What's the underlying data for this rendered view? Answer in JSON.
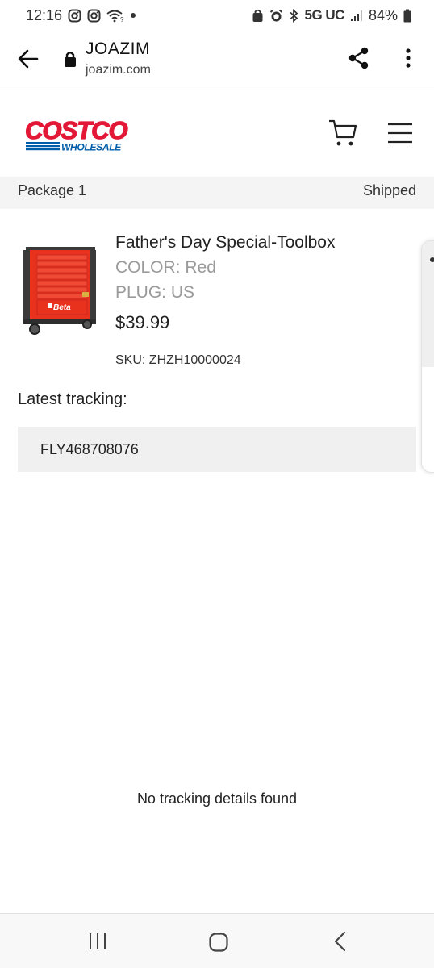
{
  "status_bar": {
    "time": "12:16",
    "network": "5G UC",
    "battery": "84%",
    "icons": [
      "instagram-icon",
      "instagram-icon",
      "wifi-question-icon",
      "dot-icon",
      "shield-icon",
      "alarm-icon",
      "bluetooth-icon",
      "signal-icon",
      "battery-icon"
    ]
  },
  "browser": {
    "title": "JOAZIM",
    "url": "joazim.com",
    "icons": [
      "back-arrow-icon",
      "lock-icon",
      "share-icon",
      "more-vertical-icon"
    ]
  },
  "header": {
    "logo_main": "COSTCO",
    "logo_sub": "WHOLESALE",
    "brand_red": "#e31837",
    "brand_blue": "#005daa",
    "icons": [
      "cart-icon",
      "hamburger-menu-icon"
    ]
  },
  "package": {
    "label": "Package 1",
    "status": "Shipped"
  },
  "product": {
    "name": "Father's Day Special-Toolbox",
    "color": "COLOR: Red",
    "plug": "PLUG: US",
    "price": "$39.99",
    "sku": "SKU: ZHZH10000024",
    "image_brand": "Beta"
  },
  "tracking": {
    "heading": "Latest tracking:",
    "number": "FLY468708076",
    "empty_message": "No tracking details found"
  },
  "nav": {
    "icons": [
      "recent-apps-icon",
      "home-icon",
      "back-icon"
    ]
  }
}
